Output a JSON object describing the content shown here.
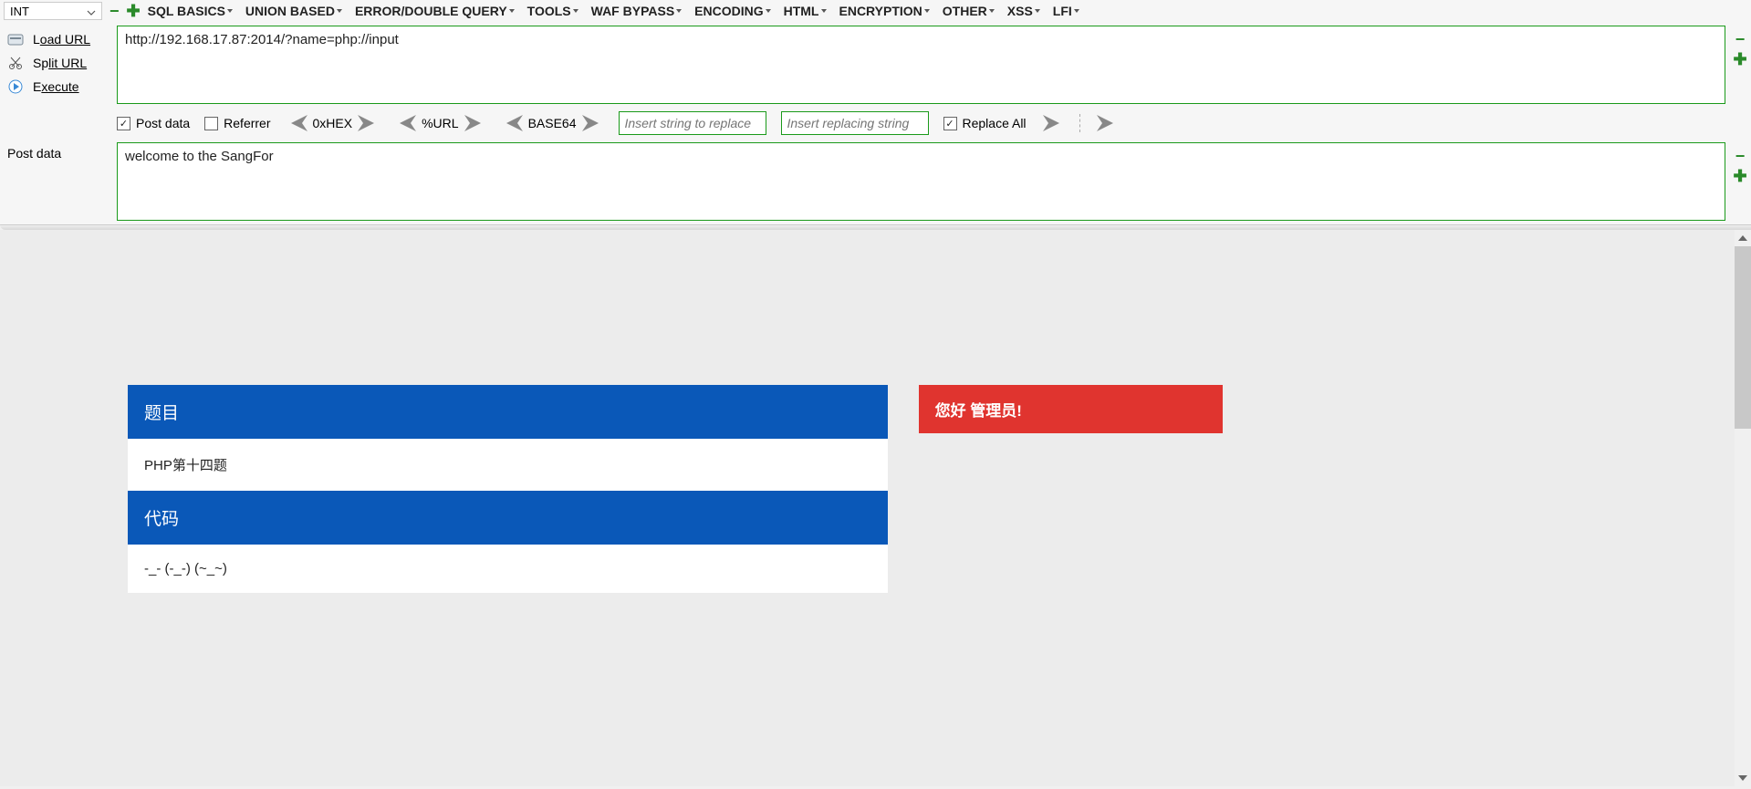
{
  "toolbar": {
    "int_label": "INT",
    "menus": [
      "SQL BASICS",
      "UNION BASED",
      "ERROR/DOUBLE QUERY",
      "TOOLS",
      "WAF BYPASS",
      "ENCODING",
      "HTML",
      "ENCRYPTION",
      "OTHER",
      "XSS",
      "LFI"
    ]
  },
  "left_actions": {
    "load_url_pre": "L",
    "load_url": "oad URL",
    "split_url_pre": "Sp",
    "split_url": "lit URL",
    "execute_pre": "E",
    "execute": "xecute"
  },
  "url_input": "http://192.168.17.87:2014/?name=php://input",
  "options": {
    "post_data": "Post data",
    "referrer": "Referrer",
    "hex": "0xHEX",
    "url_enc": "%URL",
    "base64": "BASE64",
    "replace_ph1": "Insert string to replace",
    "replace_ph2": "Insert replacing string",
    "replace_all": "Replace All"
  },
  "post": {
    "label": "Post data",
    "value": "welcome to the SangFor"
  },
  "page": {
    "title_header": "题目",
    "title_body": "PHP第十四题",
    "code_header": "代码",
    "code_body": "-_- (-_-) (~_~)",
    "admin_header": "您好 管理员!"
  }
}
